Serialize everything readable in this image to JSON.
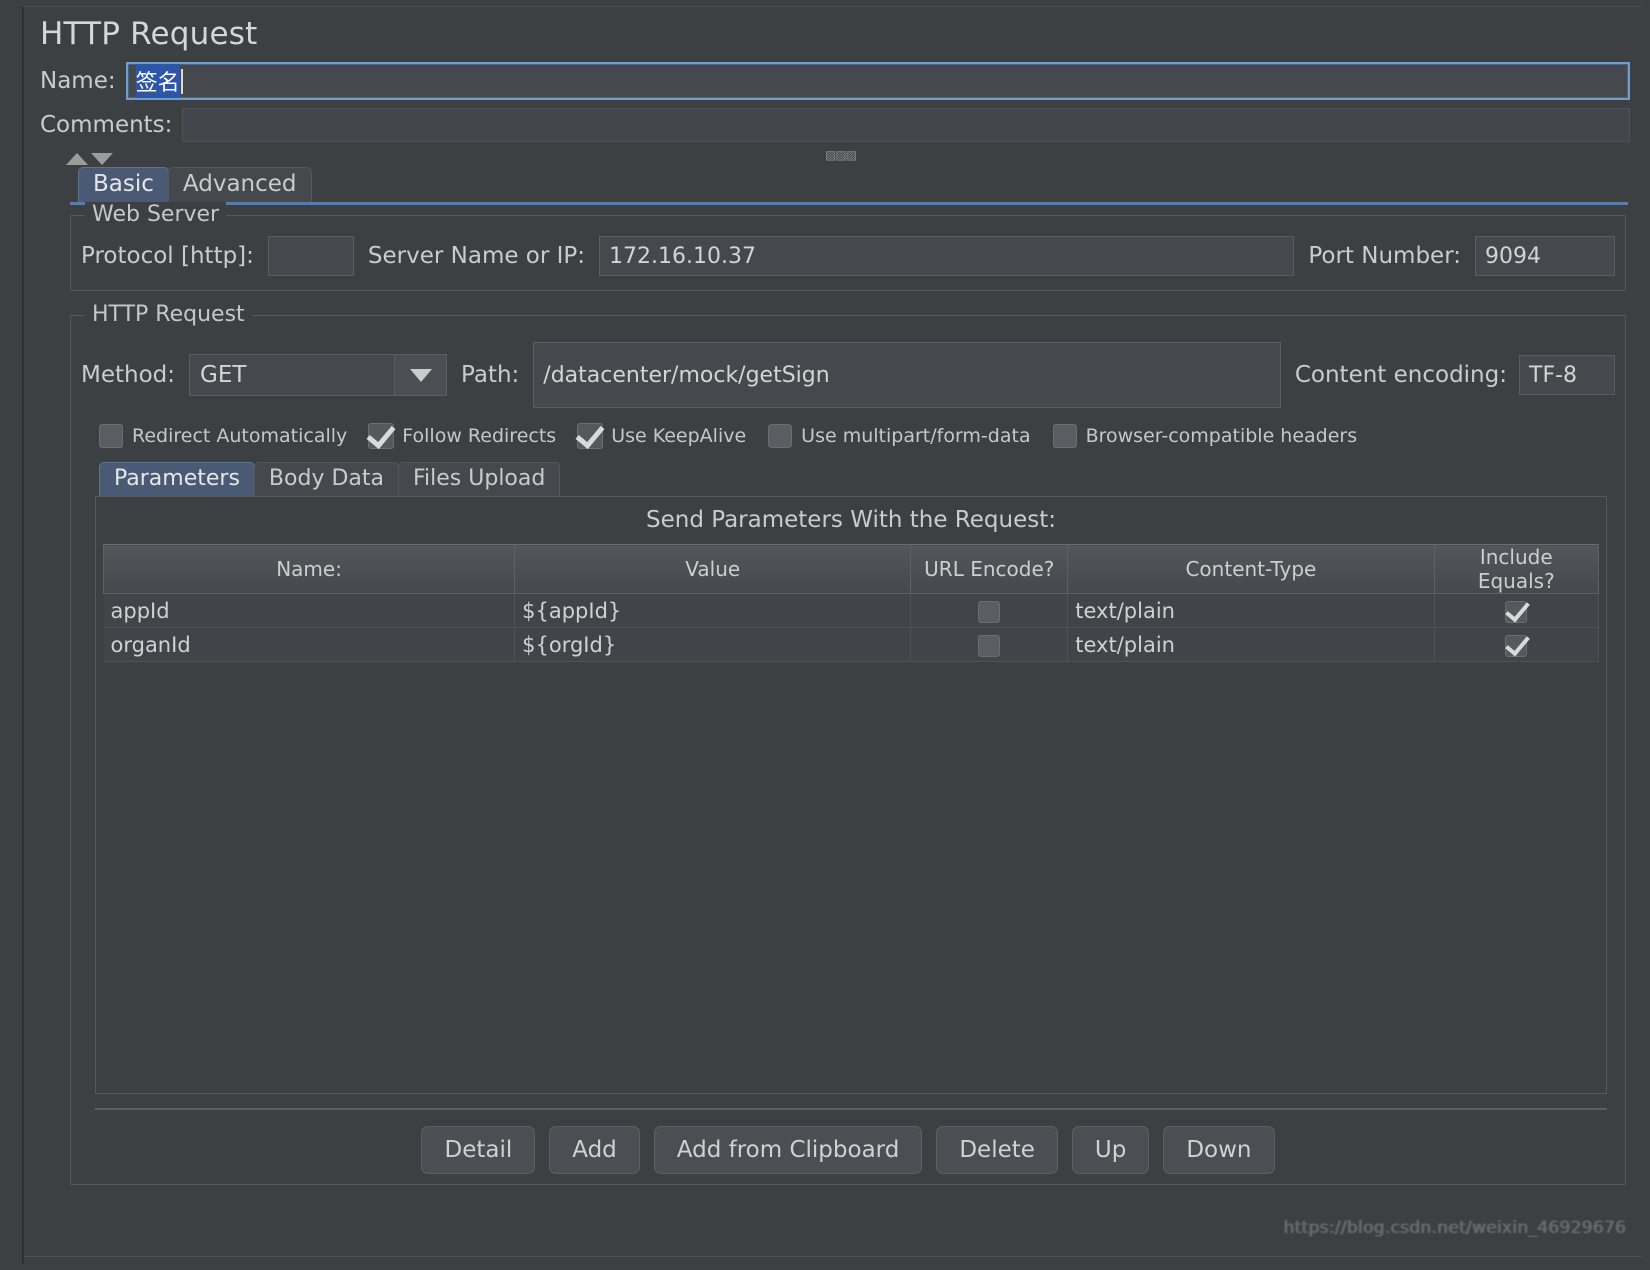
{
  "page_title": "HTTP Request",
  "name_row": {
    "label": "Name:",
    "value": "签名"
  },
  "comments_row": {
    "label": "Comments:",
    "value": ""
  },
  "tabs": [
    {
      "label": "Basic",
      "active": true
    },
    {
      "label": "Advanced",
      "active": false
    }
  ],
  "web_server": {
    "title": "Web Server",
    "protocol_label": "Protocol [http]:",
    "protocol_value": "",
    "server_label": "Server Name or IP:",
    "server_value": "172.16.10.37",
    "port_label": "Port Number:",
    "port_value": "9094"
  },
  "http_request": {
    "title": "HTTP Request",
    "method_label": "Method:",
    "method_value": "GET",
    "path_label": "Path:",
    "path_value": "/datacenter/mock/getSign",
    "encoding_label": "Content encoding:",
    "encoding_value": "TF-8"
  },
  "options": [
    {
      "label": "Redirect Automatically",
      "checked": false
    },
    {
      "label": "Follow Redirects",
      "checked": true
    },
    {
      "label": "Use KeepAlive",
      "checked": true
    },
    {
      "label": "Use multipart/form-data",
      "checked": false
    },
    {
      "label": "Browser-compatible headers",
      "checked": false
    }
  ],
  "inner_tabs": [
    {
      "label": "Parameters",
      "active": true
    },
    {
      "label": "Body Data",
      "active": false
    },
    {
      "label": "Files Upload",
      "active": false
    }
  ],
  "parameters_table": {
    "caption": "Send Parameters With the Request:",
    "columns": [
      "Name:",
      "Value",
      "URL Encode?",
      "Content-Type",
      "Include Equals?"
    ],
    "rows": [
      {
        "name": "appId",
        "value": "${appId}",
        "url_encode": false,
        "content_type": "text/plain",
        "include_equals": true
      },
      {
        "name": "organId",
        "value": "${orgId}",
        "url_encode": false,
        "content_type": "text/plain",
        "include_equals": true
      }
    ]
  },
  "buttons": [
    {
      "label": "Detail"
    },
    {
      "label": "Add"
    },
    {
      "label": "Add from Clipboard"
    },
    {
      "label": "Delete"
    },
    {
      "label": "Up"
    },
    {
      "label": "Down"
    }
  ],
  "watermark": "https://blog.csdn.net/weixin_46929676",
  "colors": {
    "background": "#3c4043",
    "field": "#45494d",
    "accent_tab": "#4a5a75",
    "selection": "#2f56a6",
    "focus_border": "#6f9dd1",
    "text": "#c8cacb"
  }
}
